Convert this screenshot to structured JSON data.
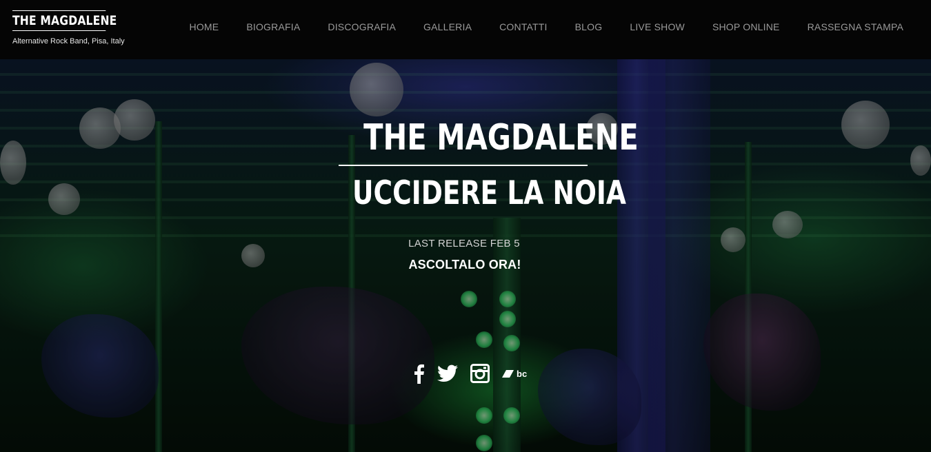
{
  "brand": {
    "title": "THE MAGDALENE",
    "tagline": "Alternative Rock Band, Pisa, Italy"
  },
  "nav": {
    "items": [
      {
        "label": "HOME"
      },
      {
        "label": "BIOGRAFIA"
      },
      {
        "label": "DISCOGRAFIA"
      },
      {
        "label": "GALLERIA"
      },
      {
        "label": "CONTATTI"
      },
      {
        "label": "BLOG"
      },
      {
        "label": "LIVE SHOW"
      },
      {
        "label": "SHOP ONLINE"
      },
      {
        "label": "RASSEGNA STAMPA"
      }
    ]
  },
  "hero": {
    "title": "THE MAGDALENE",
    "subtitle": "UCCIDERE LA NOIA",
    "release": "LAST RELEASE FEB 5",
    "cta": "ASCOLTALO ORA!"
  },
  "social": {
    "icons": [
      "facebook-icon",
      "twitter-icon",
      "instagram-icon",
      "bandcamp-icon"
    ],
    "bandcamp_text": "bc"
  },
  "colors": {
    "header_bg": "#050505",
    "nav_text": "#9a9a9a",
    "hero_text": "#ffffff"
  }
}
